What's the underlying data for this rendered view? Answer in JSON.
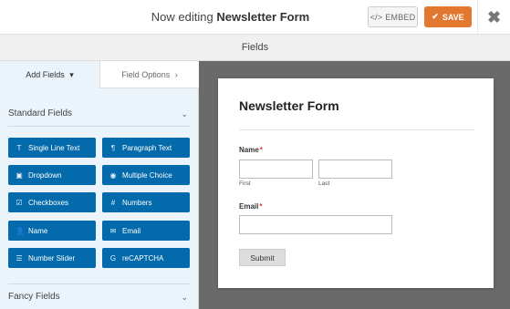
{
  "header": {
    "title_prefix": "Now editing",
    "form_name": "Newsletter Form",
    "embed_icon": "</>",
    "embed_label": "EMBED",
    "save_icon": "✔",
    "save_label": "SAVE",
    "close_icon": "✖",
    "save_color": "#e27730"
  },
  "fields_bar": {
    "label": "Fields"
  },
  "sidebar": {
    "tabs": [
      {
        "label": "Add Fields",
        "icon": "▾"
      },
      {
        "label": "Field Options",
        "icon": "›"
      }
    ],
    "standard_section": {
      "label": "Standard Fields",
      "icon": "⌄"
    },
    "fancy_section": {
      "label": "Fancy Fields",
      "icon": "⌄"
    },
    "field_buttons": [
      {
        "label": "Single Line Text",
        "icon": "T",
        "icon_name": "text-icon"
      },
      {
        "label": "Paragraph Text",
        "icon": "¶",
        "icon_name": "paragraph-icon"
      },
      {
        "label": "Dropdown",
        "icon": "▣",
        "icon_name": "dropdown-icon"
      },
      {
        "label": "Multiple Choice",
        "icon": "◉",
        "icon_name": "radio-icon"
      },
      {
        "label": "Checkboxes",
        "icon": "☑",
        "icon_name": "checkbox-icon"
      },
      {
        "label": "Numbers",
        "icon": "#",
        "icon_name": "hash-icon"
      },
      {
        "label": "Name",
        "icon": "👤",
        "icon_name": "user-icon"
      },
      {
        "label": "Email",
        "icon": "✉",
        "icon_name": "envelope-icon"
      },
      {
        "label": "Number Slider",
        "icon": "☰",
        "icon_name": "sliders-icon"
      },
      {
        "label": "reCAPTCHA",
        "icon": "G",
        "icon_name": "google-icon"
      }
    ],
    "button_color": "#036aab"
  },
  "form": {
    "title": "Newsletter Form",
    "name_label": "Name",
    "required_mark": "*",
    "first_sublabel": "First",
    "last_sublabel": "Last",
    "email_label": "Email",
    "submit_label": "Submit"
  }
}
